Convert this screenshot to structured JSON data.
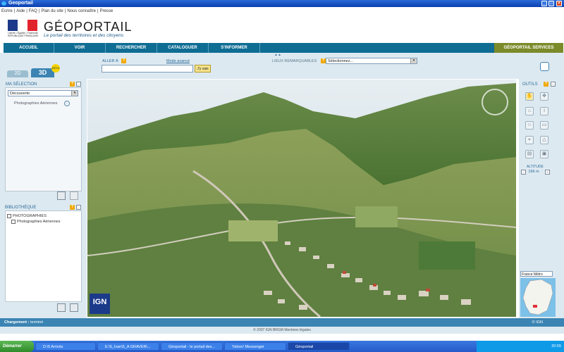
{
  "window": {
    "title": "Geoportail"
  },
  "toplinks": [
    "Ecrire",
    "Aide",
    "FAQ",
    "Plan du site",
    "Nous connaître",
    "Presse"
  ],
  "header": {
    "title": "GÉOPORTAIL",
    "tagline": "Le portail des territoires et des citoyens",
    "brand": "Liberté • Égalité • Fraternité RÉPUBLIQUE FRANÇAISE"
  },
  "nav": {
    "items": [
      "ACCUEIL",
      "VOIR",
      "RECHERCHER",
      "CATALOGUER",
      "S'INFORMER"
    ],
    "services": "GÉOPORTAIL SERVICES"
  },
  "tabs": {
    "tab2d": "2D",
    "tab3d": "3D",
    "beta": "BÊTA"
  },
  "search": {
    "label": "ALLER À",
    "advanced": "Mode avancé",
    "go": "J'y vais",
    "value": ""
  },
  "lieux": {
    "label": "LIEUX REMARQUABLES",
    "selected": "Sélectionnez..."
  },
  "selection": {
    "header": "MA SÉLECTION",
    "dropdown": "Découverte",
    "item": "Photographies Aériennes"
  },
  "bibliotheque": {
    "header": "BIBLIOTHÈQUE",
    "group": "PHOTOGRAPHIES",
    "item": "Photographies Aériennes"
  },
  "map": {
    "logo": "IGN"
  },
  "tools": {
    "header": "OUTILS",
    "altitude_label": "ALTITUDE",
    "altitude_value": "196 m",
    "region": "France Métro",
    "icons": [
      "hand-icon",
      "move-icon",
      "home-icon",
      "info-icon",
      "star-icon",
      "folder-icon",
      "measure-icon",
      "warning-icon",
      "print-icon",
      "save-icon"
    ]
  },
  "status": {
    "label": "Chargement :",
    "value": "terminé",
    "right": "© IGN",
    "copyright": "© 2007 IGN BRGM Mentions légales"
  },
  "taskbar": {
    "start": "Démarrer",
    "tasks": [
      "D:\\5 Arrivés",
      "E:\\5_Ivan\\5_A GRAVER\\...",
      "Géoportail - le portail des...",
      "Yahoo! Messenger",
      "Géoportail"
    ],
    "time": "20:55"
  },
  "colors": {
    "nav": "#0f6d94",
    "services": "#7b8b2a",
    "panel": "#dde9f0",
    "status": "#3b84b3"
  }
}
